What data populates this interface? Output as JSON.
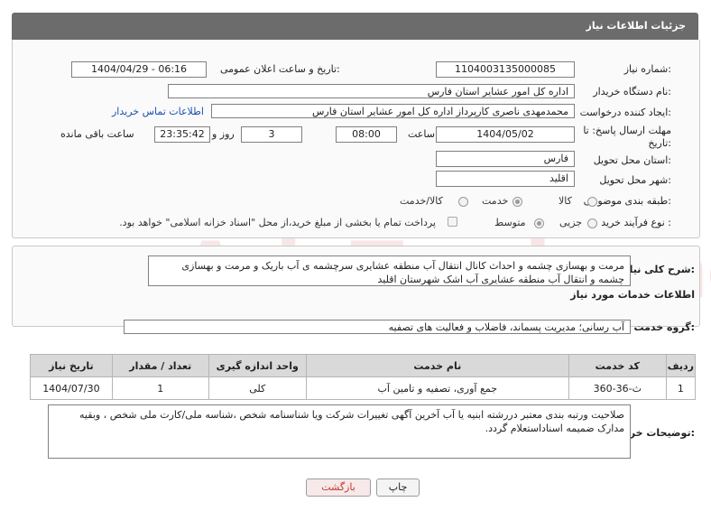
{
  "header": {
    "title": "جزئیات اطلاعات نیاز"
  },
  "need_number": {
    "label": "شماره نیاز:",
    "value": "1104003135000085"
  },
  "announce": {
    "label": "تاریخ و ساعت اعلان عمومی:",
    "value": "1404/04/29 - 06:16"
  },
  "buyer_org": {
    "label": "نام دستگاه خریدار:",
    "value": "اداره کل امور عشایر استان فارس"
  },
  "requester": {
    "label": "ایجاد کننده درخواست:",
    "value": "محمدمهدی ناصری کارپرداز اداره کل امور عشایر استان فارس",
    "contact_link": "اطلاعات تماس خریدار"
  },
  "deadline": {
    "label_line1": "مهلت ارسال پاسخ: تا",
    "label_line2": "تاریخ:",
    "date": "1404/05/02",
    "time_label": "ساعت",
    "time": "08:00",
    "days": "3",
    "days_label": "روز و",
    "remaining": "23:35:42",
    "remaining_label": "ساعت باقی مانده"
  },
  "delivery_province": {
    "label": "استان محل تحویل:",
    "value": "فارس"
  },
  "delivery_city": {
    "label": "شهر محل تحویل:",
    "value": "اقلید"
  },
  "category": {
    "label": "طبقه بندی موضوعی:",
    "options": [
      "کالا",
      "خدمت",
      "کالا/خدمت"
    ],
    "selected": "خدمت"
  },
  "process": {
    "label": "نوع فرآیند خرید :",
    "options": [
      "جزیی",
      "متوسط"
    ],
    "selected": "متوسط",
    "treasury_note": "پرداخت تمام یا بخشی از مبلغ خرید،از محل \"اسناد خزانه اسلامی\" خواهد بود."
  },
  "summary": {
    "label": "شرح کلی نیاز:",
    "text": "مرمت و بهسازی چشمه و احداث کانال انتقال آب منطقه عشایری سرچشمه ی آب باریک و مرمت و بهسازی چشمه و انتقال آب منطقه عشایری آب اشک شهرستان اقلید"
  },
  "services_section": {
    "title": "اطلاعات خدمات مورد نیاز"
  },
  "service_group": {
    "label": "گروه خدمت:",
    "value": "آب رسانی؛ مدیریت پسماند، فاضلاب و فعالیت های تصفیه"
  },
  "table": {
    "headers": [
      "ردیف",
      "کد خدمت",
      "نام خدمت",
      "واحد اندازه گیری",
      "تعداد / مقدار",
      "تاریخ نیاز"
    ],
    "rows": [
      [
        "1",
        "ث-36-360",
        "جمع آوری، تصفیه و تامین آب",
        "کلی",
        "1",
        "1404/07/30"
      ]
    ]
  },
  "buyer_notes": {
    "label": "توضیحات خریدار:",
    "text": "صلاحیت ورتبه بندی معتبر دررشته  ابنیه یا آب  آخرین آگهی تغییرات شرکت ویا شناسنامه شخص ،شناسه ملی/کارت ملی شخص ، وبقیه مدارک  ضمیمه اسناداستعلام گردد."
  },
  "buttons": {
    "print": "چاپ",
    "back": "بازگشت"
  },
  "colors": {
    "header_bg": "#6c6c6c",
    "link": "#1a4fb3",
    "back_text": "#c0392b"
  }
}
